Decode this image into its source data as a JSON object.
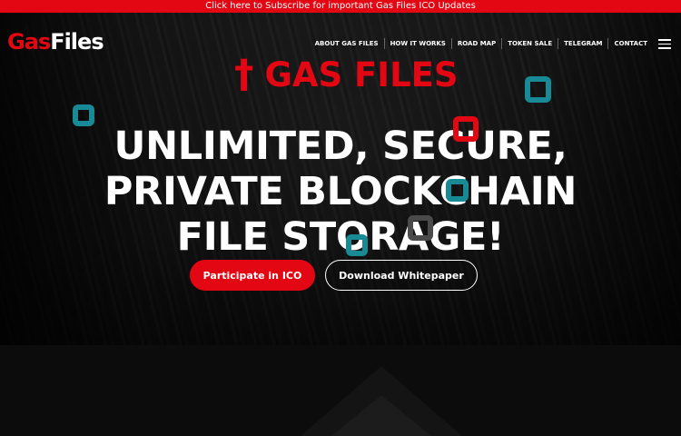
{
  "announcement": {
    "text": "Click here to Subscribe for important Gas Files ICO Updates"
  },
  "brand": {
    "logo_prefix": "Gas",
    "logo_suffix": "Files"
  },
  "navigation": {
    "items": [
      {
        "label": "ABOUT GAS FILES"
      },
      {
        "label": "HOW IT WORKS"
      },
      {
        "label": "ROAD MAP"
      },
      {
        "label": "TOKEN SALE"
      },
      {
        "label": "TELEGRAM"
      },
      {
        "label": "CONTACT"
      }
    ],
    "menu_icon": "hamburger-menu-icon"
  },
  "hero": {
    "eyebrow_icon": "†",
    "eyebrow": "GAS FILES",
    "headline_lines": [
      "UNLIMITED, SECURE,",
      "PRIVATE BLOCKCHAIN",
      "FILE STORAGE!"
    ],
    "primary_button": "Participate in ICO",
    "secondary_button": "Download Whitepaper"
  },
  "decorations": {
    "marker_icon": "square-marker-icon"
  },
  "colors": {
    "brand_red": "#e30613",
    "teal": "#178a96",
    "white": "#ffffff",
    "background": "#0b0b0b",
    "dark_gray": "#4a4a4a"
  }
}
